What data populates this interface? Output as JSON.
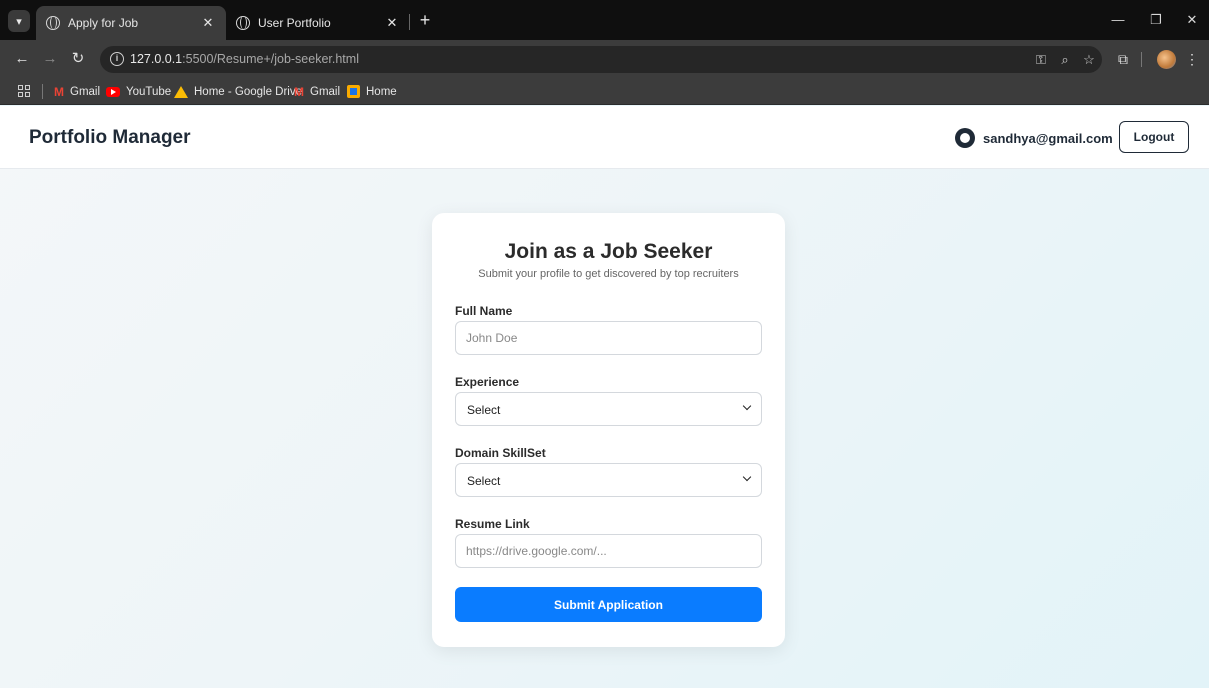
{
  "browser": {
    "tabs": [
      {
        "title": "Apply for Job",
        "active": true
      },
      {
        "title": "User Portfolio",
        "active": false
      }
    ],
    "url_host": "127.0.0.1",
    "url_path": ":5500/Resume+/job-seeker.html",
    "bookmarks": [
      {
        "label": "Gmail",
        "icon": "gmail-icon"
      },
      {
        "label": "YouTube",
        "icon": "youtube-icon"
      },
      {
        "label": "Home - Google Drive",
        "icon": "google-drive-icon"
      },
      {
        "label": "Gmail",
        "icon": "gmail-icon"
      },
      {
        "label": "Home",
        "icon": "home-icon"
      }
    ]
  },
  "navbar": {
    "brand": "Portfolio Manager",
    "user_email": "sandhya@gmail.com",
    "logout_label": "Logout"
  },
  "form": {
    "title": "Join as a Job Seeker",
    "subtitle": "Submit your profile to get discovered by top recruiters",
    "full_name": {
      "label": "Full Name",
      "placeholder": "John Doe",
      "value": ""
    },
    "experience": {
      "label": "Experience",
      "selected": "Select"
    },
    "domain": {
      "label": "Domain SkillSet",
      "selected": "Select"
    },
    "resume": {
      "label": "Resume Link",
      "placeholder": "https://drive.google.com/...",
      "value": ""
    },
    "submit_label": "Submit Application"
  },
  "colors": {
    "primary": "#0a7cff",
    "navbar_text": "#1f2a37",
    "chrome_dark": "#0f0f0f",
    "chrome_toolbar": "#3c3c3c"
  }
}
